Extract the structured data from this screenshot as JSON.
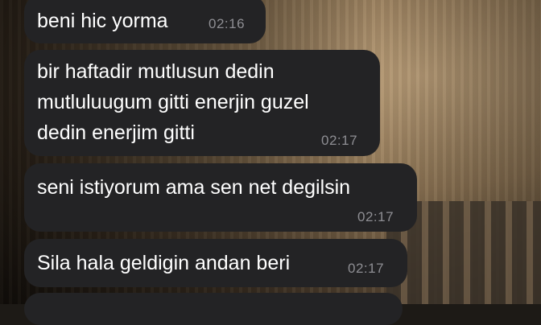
{
  "chat": {
    "messages": [
      {
        "text": "beni hic yorma",
        "time": "02:16"
      },
      {
        "text": "bir haftadir mutlusun dedin\nmutluluugum gitti enerjin guzel\ndedin enerjim gitti",
        "time": "02:17"
      },
      {
        "text": "seni istiyorum ama sen net degilsin",
        "time": "02:17"
      },
      {
        "text": "Sila hala geldigin andan beri",
        "time": "02:17"
      }
    ]
  },
  "colors": {
    "bubble_background": "#232325",
    "message_text": "#ffffff",
    "timestamp_text": "#8e8e93"
  }
}
